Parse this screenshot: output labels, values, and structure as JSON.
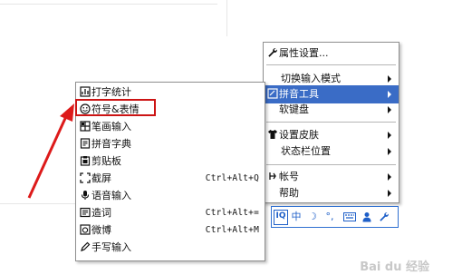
{
  "main_menu": {
    "items": [
      {
        "label": "属性设置...",
        "icon": "wrench-icon",
        "has_submenu": false
      },
      {
        "label": "切换输入模式",
        "icon": "",
        "has_submenu": true
      },
      {
        "label": "拼音工具",
        "icon": "pinyin-tool-icon",
        "has_submenu": true,
        "highlighted": true
      },
      {
        "label": "软键盘",
        "icon": "",
        "has_submenu": true
      },
      {
        "label": "设置皮肤",
        "icon": "shirt-icon",
        "has_submenu": true
      },
      {
        "label": "状态栏位置",
        "icon": "",
        "has_submenu": true
      },
      {
        "label": "帐号",
        "icon": "account-icon",
        "has_submenu": true
      },
      {
        "label": "帮助",
        "icon": "",
        "has_submenu": true
      }
    ]
  },
  "submenu": {
    "items": [
      {
        "label": "打字统计",
        "icon": "stats-icon",
        "shortcut": ""
      },
      {
        "label": "符号&表情",
        "icon": "smiley-icon",
        "shortcut": ""
      },
      {
        "label": "笔画输入",
        "icon": "grid-icon",
        "shortcut": ""
      },
      {
        "label": "拼音字典",
        "icon": "dictionary-icon",
        "shortcut": ""
      },
      {
        "label": "剪贴板",
        "icon": "clipboard-icon",
        "shortcut": ""
      },
      {
        "label": "截屏",
        "icon": "screenshot-icon",
        "shortcut": "Ctrl+Alt+Q"
      },
      {
        "label": "语音输入",
        "icon": "microphone-icon",
        "shortcut": ""
      },
      {
        "label": "造词",
        "icon": "word-icon",
        "shortcut": "Ctrl+Alt+="
      },
      {
        "label": "微博",
        "icon": "weibo-icon",
        "shortcut": "Ctrl+Alt+M"
      },
      {
        "label": "手写输入",
        "icon": "pen-icon",
        "shortcut": ""
      }
    ]
  },
  "status_bar": {
    "logo": "IQ",
    "mode": "中",
    "moon": "☽",
    "punct": "°,",
    "symbols": [
      "soft-keyboard-icon",
      "user-icon",
      "wrench-icon"
    ]
  },
  "colors": {
    "highlight": "#3a6cc6",
    "annotation": "#cc1414",
    "toolbar": "#1e5fc8"
  },
  "watermark": "Bai du 经验"
}
